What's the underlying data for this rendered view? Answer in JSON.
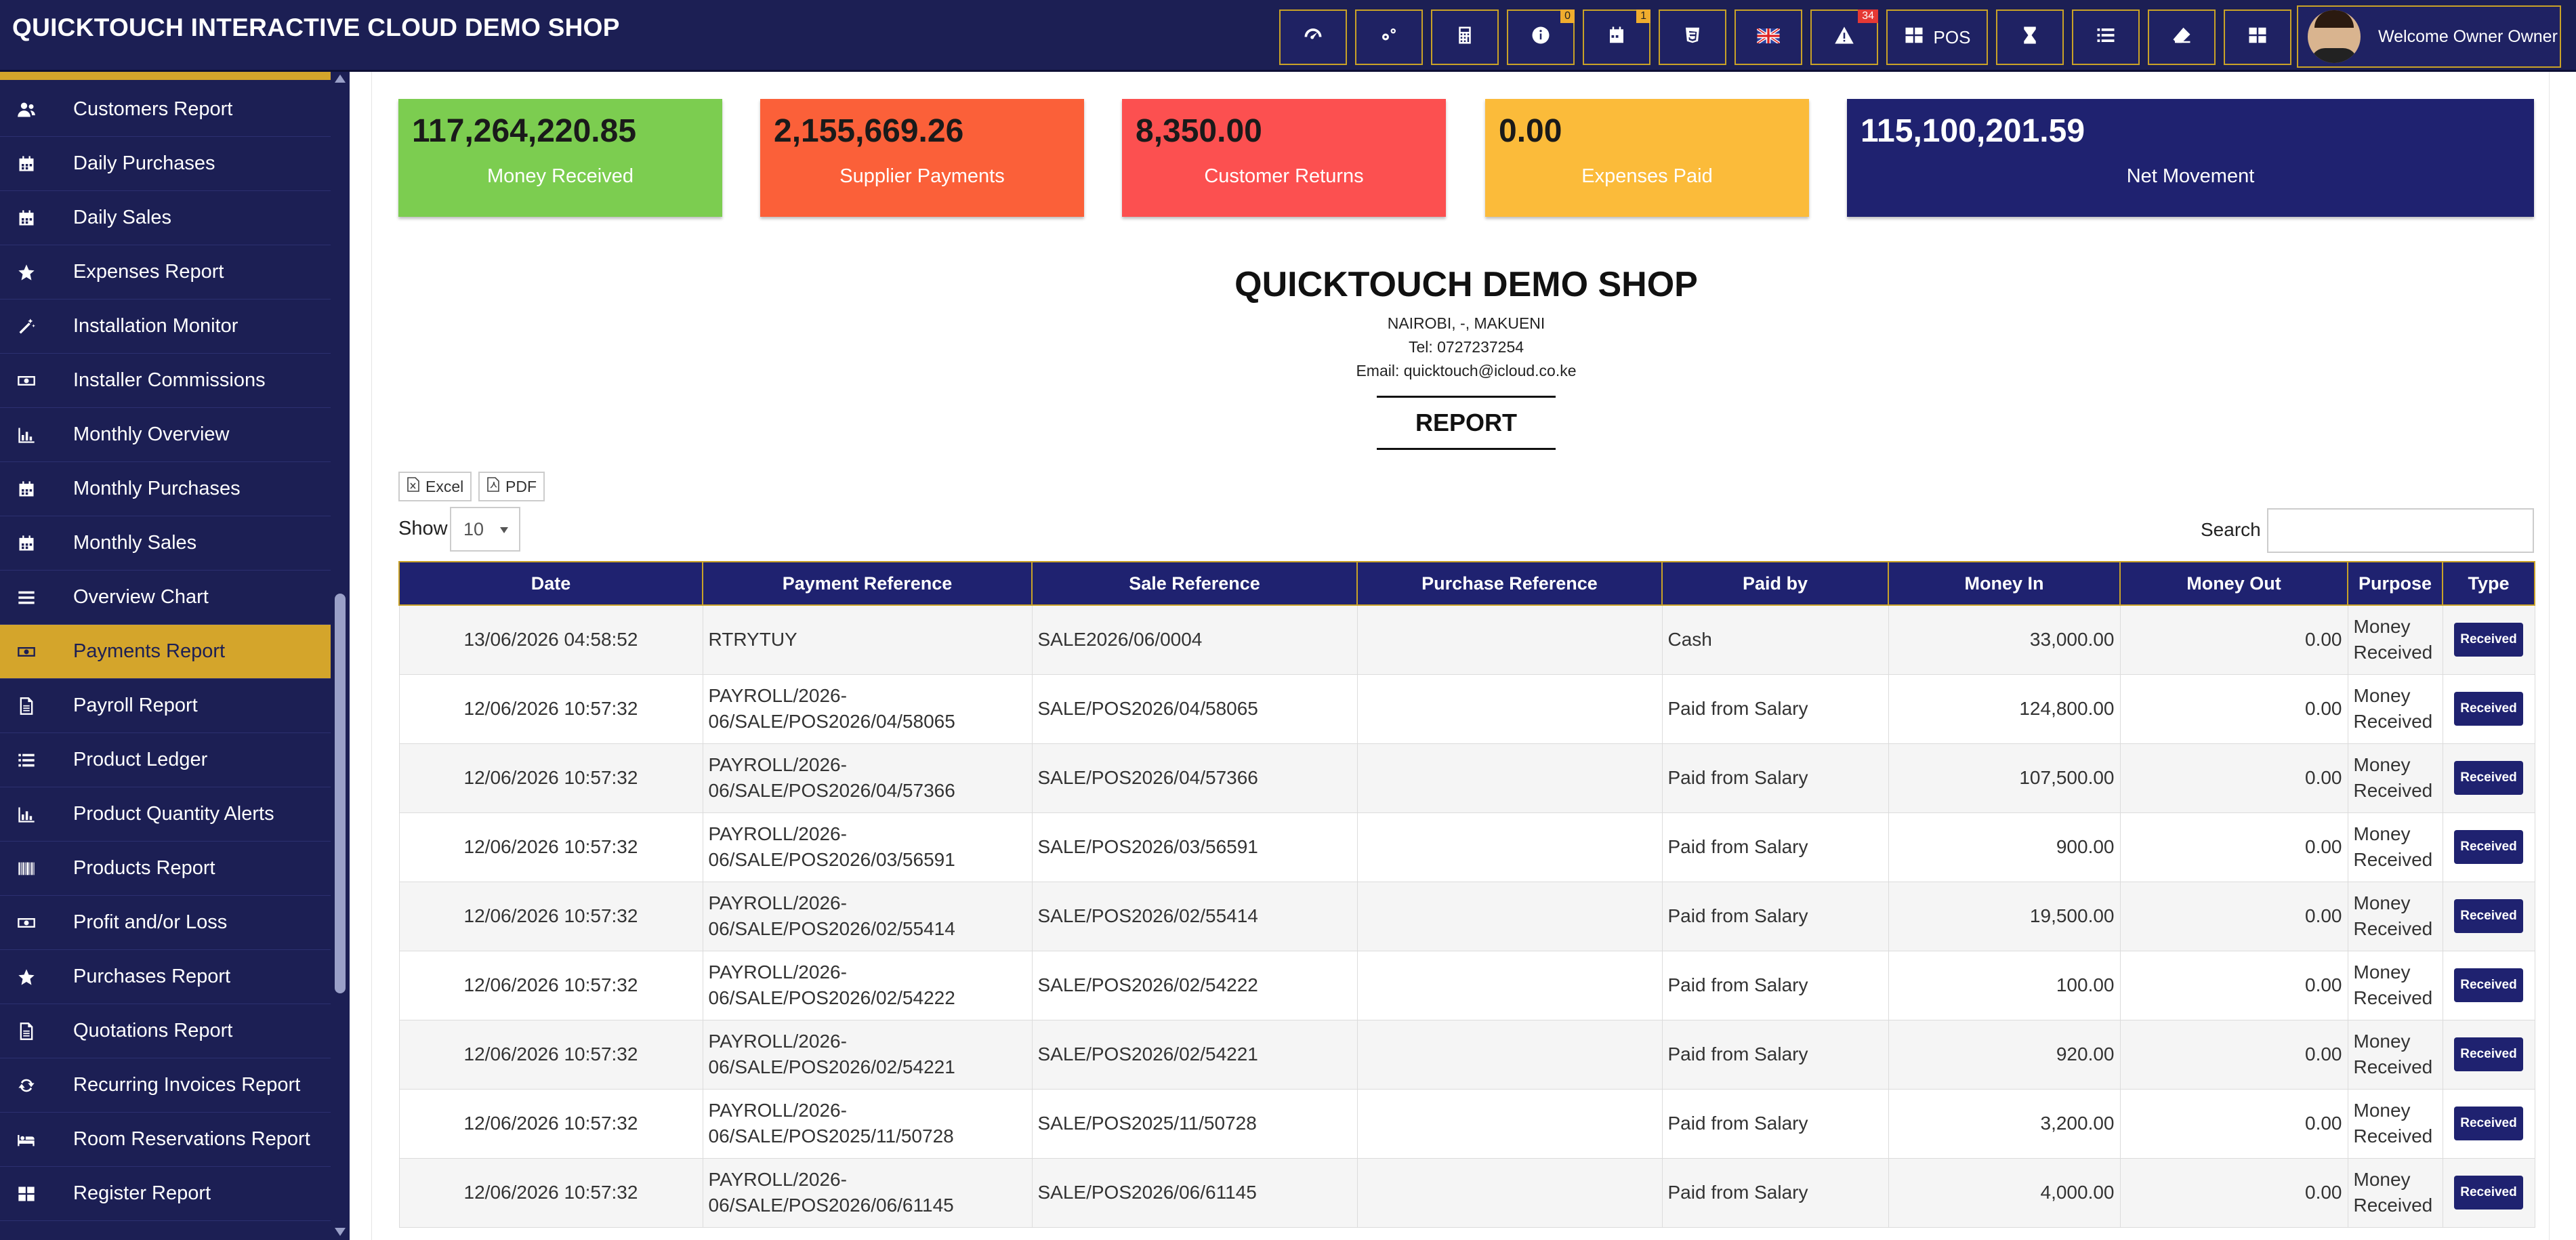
{
  "app": {
    "title": "QUICKTOUCH INTERACTIVE CLOUD DEMO SHOP",
    "pos_label": "POS",
    "badges": {
      "info": "0",
      "calendar": "1",
      "alerts": "34"
    },
    "welcome": "Welcome Owner Owner"
  },
  "sidebar": {
    "items": [
      {
        "label": "Customers Report",
        "icon": "users-icon",
        "active": false
      },
      {
        "label": "Daily Purchases",
        "icon": "calendar-icon",
        "active": false
      },
      {
        "label": "Daily Sales",
        "icon": "calendar-icon",
        "active": false
      },
      {
        "label": "Expenses Report",
        "icon": "star-icon",
        "active": false
      },
      {
        "label": "Installation Monitor",
        "icon": "wand-icon",
        "active": false
      },
      {
        "label": "Installer Commissions",
        "icon": "money-icon",
        "active": false
      },
      {
        "label": "Monthly Overview",
        "icon": "bar-chart-icon",
        "active": false
      },
      {
        "label": "Monthly Purchases",
        "icon": "calendar-icon",
        "active": false
      },
      {
        "label": "Monthly Sales",
        "icon": "calendar-icon",
        "active": false
      },
      {
        "label": "Overview Chart",
        "icon": "bars-icon",
        "active": false
      },
      {
        "label": "Payments Report",
        "icon": "money-icon",
        "active": true
      },
      {
        "label": "Payroll Report",
        "icon": "file-icon",
        "active": false
      },
      {
        "label": "Product Ledger",
        "icon": "list-icon",
        "active": false
      },
      {
        "label": "Product Quantity Alerts",
        "icon": "bar-chart-icon",
        "active": false
      },
      {
        "label": "Products Report",
        "icon": "barcode-icon",
        "active": false
      },
      {
        "label": "Profit and/or Loss",
        "icon": "money-icon",
        "active": false
      },
      {
        "label": "Purchases Report",
        "icon": "star-icon",
        "active": false
      },
      {
        "label": "Quotations Report",
        "icon": "file-icon",
        "active": false
      },
      {
        "label": "Recurring Invoices Report",
        "icon": "refresh-icon",
        "active": false
      },
      {
        "label": "Room Reservations Report",
        "icon": "bed-icon",
        "active": false
      },
      {
        "label": "Register Report",
        "icon": "grid-icon",
        "active": false
      }
    ]
  },
  "cards": [
    {
      "amount": "117,264,220.85",
      "label": "Money Received",
      "color": "#7ccd50"
    },
    {
      "amount": "2,155,669.26",
      "label": "Supplier Payments",
      "color": "#fb6039"
    },
    {
      "amount": "8,350.00",
      "label": "Customer Returns",
      "color": "#fc5050"
    },
    {
      "amount": "0.00",
      "label": "Expenses Paid",
      "color": "#fbbb3a"
    },
    {
      "amount": "115,100,201.59",
      "label": "Net Movement",
      "color": "#1f2270"
    }
  ],
  "shop": {
    "name": "QUICKTOUCH DEMO SHOP",
    "address": "NAIROBI, -, MAKUENI",
    "tel": "Tel: 0727237254",
    "email": "Email: quicktouch@icloud.co.ke",
    "report_title": "REPORT"
  },
  "controls": {
    "excel": "Excel",
    "pdf": "PDF",
    "show_label": "Show",
    "show_value": "10",
    "search_label": "Search",
    "search_value": ""
  },
  "table": {
    "columns": [
      "Date",
      "Payment Reference",
      "Sale Reference",
      "Purchase Reference",
      "Paid by",
      "Money In",
      "Money Out",
      "Purpose",
      "Type"
    ],
    "rows": [
      {
        "date": "13/06/2026 04:58:52",
        "payment_ref": "RTRYTUY",
        "sale_ref": "SALE2026/06/0004",
        "purchase_ref": "",
        "paid_by": "Cash",
        "money_in": "33,000.00",
        "money_out": "0.00",
        "purpose": "Money Received",
        "type": "Received"
      },
      {
        "date": "12/06/2026 10:57:32",
        "payment_ref": "PAYROLL/2026-06/SALE/POS2026/04/58065",
        "sale_ref": "SALE/POS2026/04/58065",
        "purchase_ref": "",
        "paid_by": "Paid from Salary",
        "money_in": "124,800.00",
        "money_out": "0.00",
        "purpose": "Money Received",
        "type": "Received"
      },
      {
        "date": "12/06/2026 10:57:32",
        "payment_ref": "PAYROLL/2026-06/SALE/POS2026/04/57366",
        "sale_ref": "SALE/POS2026/04/57366",
        "purchase_ref": "",
        "paid_by": "Paid from Salary",
        "money_in": "107,500.00",
        "money_out": "0.00",
        "purpose": "Money Received",
        "type": "Received"
      },
      {
        "date": "12/06/2026 10:57:32",
        "payment_ref": "PAYROLL/2026-06/SALE/POS2026/03/56591",
        "sale_ref": "SALE/POS2026/03/56591",
        "purchase_ref": "",
        "paid_by": "Paid from Salary",
        "money_in": "900.00",
        "money_out": "0.00",
        "purpose": "Money Received",
        "type": "Received"
      },
      {
        "date": "12/06/2026 10:57:32",
        "payment_ref": "PAYROLL/2026-06/SALE/POS2026/02/55414",
        "sale_ref": "SALE/POS2026/02/55414",
        "purchase_ref": "",
        "paid_by": "Paid from Salary",
        "money_in": "19,500.00",
        "money_out": "0.00",
        "purpose": "Money Received",
        "type": "Received"
      },
      {
        "date": "12/06/2026 10:57:32",
        "payment_ref": "PAYROLL/2026-06/SALE/POS2026/02/54222",
        "sale_ref": "SALE/POS2026/02/54222",
        "purchase_ref": "",
        "paid_by": "Paid from Salary",
        "money_in": "100.00",
        "money_out": "0.00",
        "purpose": "Money Received",
        "type": "Received"
      },
      {
        "date": "12/06/2026 10:57:32",
        "payment_ref": "PAYROLL/2026-06/SALE/POS2026/02/54221",
        "sale_ref": "SALE/POS2026/02/54221",
        "purchase_ref": "",
        "paid_by": "Paid from Salary",
        "money_in": "920.00",
        "money_out": "0.00",
        "purpose": "Money Received",
        "type": "Received"
      },
      {
        "date": "12/06/2026 10:57:32",
        "payment_ref": "PAYROLL/2026-06/SALE/POS2025/11/50728",
        "sale_ref": "SALE/POS2025/11/50728",
        "purchase_ref": "",
        "paid_by": "Paid from Salary",
        "money_in": "3,200.00",
        "money_out": "0.00",
        "purpose": "Money Received",
        "type": "Received"
      },
      {
        "date": "12/06/2026 10:57:32",
        "payment_ref": "PAYROLL/2026-06/SALE/POS2026/06/61145",
        "sale_ref": "SALE/POS2026/06/61145",
        "purchase_ref": "",
        "paid_by": "Paid from Salary",
        "money_in": "4,000.00",
        "money_out": "0.00",
        "purpose": "Money Received",
        "type": "Received"
      }
    ]
  },
  "colors": {
    "navy": "#1c1f54",
    "gold": "#d4a52b",
    "header_navy": "#1f2270"
  }
}
